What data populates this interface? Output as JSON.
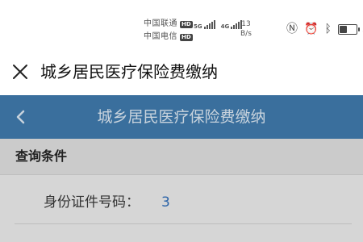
{
  "status_bar": {
    "carrier1": "中国联通",
    "carrier2": "中国电信",
    "hd": "HD",
    "net1": "5G",
    "net2": "4G",
    "speed_value": "13",
    "speed_unit": "B/s",
    "battery_percent_text": "5",
    "battery_level": 0.5
  },
  "app_bar": {
    "title": "城乡居民医疗保险费缴纳"
  },
  "page_header": {
    "title": "城乡居民医疗保险费缴纳"
  },
  "query": {
    "section_title": "查询条件",
    "id_label": "身份证件号码：",
    "id_value": "3"
  },
  "colors": {
    "header_bg": "#3a6f9d",
    "content_bg": "#d6d6d6",
    "value_text": "#2a63a8"
  }
}
